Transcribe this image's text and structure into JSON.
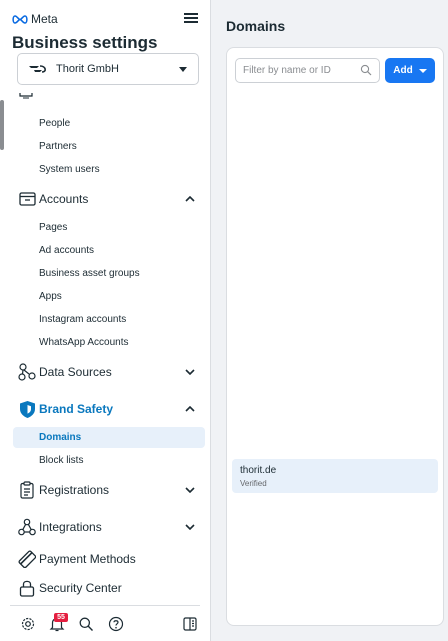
{
  "header": {
    "brand": "Meta",
    "title": "Business settings"
  },
  "business_select": {
    "name": "Thorit GmbH"
  },
  "sidebar": {
    "users_sub": [
      "People",
      "Partners",
      "System users"
    ],
    "accounts": {
      "label": "Accounts",
      "items": [
        "Pages",
        "Ad accounts",
        "Business asset groups",
        "Apps",
        "Instagram accounts",
        "WhatsApp Accounts"
      ]
    },
    "data_sources": {
      "label": "Data Sources"
    },
    "brand_safety": {
      "label": "Brand Safety",
      "items": [
        "Domains",
        "Block lists"
      ]
    },
    "registrations": {
      "label": "Registrations"
    },
    "integrations": {
      "label": "Integrations"
    },
    "payment_methods": {
      "label": "Payment Methods"
    },
    "security_center": {
      "label": "Security Center"
    }
  },
  "bottom_bar": {
    "notification_count": "55"
  },
  "main": {
    "title": "Domains",
    "filter_placeholder": "Filter by name or ID",
    "add_label": "Add",
    "domains": [
      {
        "name": "thorit.de",
        "status": "Verified"
      }
    ]
  },
  "colors": {
    "accent": "#1877f2",
    "active_text": "#0a78be",
    "active_bg": "#e7f0fa",
    "badge": "#e41e3f"
  }
}
